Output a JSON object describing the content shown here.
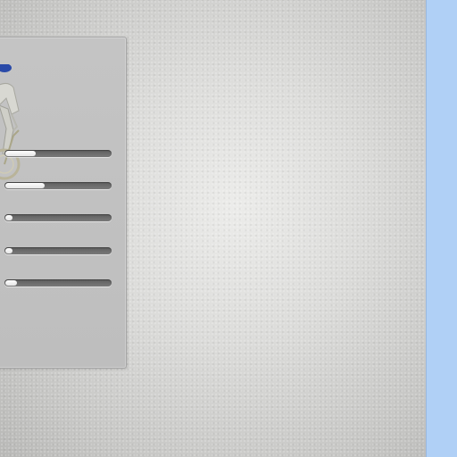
{
  "window": {
    "background": "#d9d9d7",
    "side_strip_color": "#b0d0f6"
  },
  "panel": {
    "figure_icon": "bicycle-rider-figure",
    "sliders": [
      {
        "name": "slider-1",
        "fraction": 0.29
      },
      {
        "name": "slider-2",
        "fraction": 0.37
      },
      {
        "name": "slider-3",
        "fraction": 0.03
      },
      {
        "name": "slider-4",
        "fraction": 0.06
      },
      {
        "name": "slider-5",
        "fraction": 0.11
      }
    ]
  }
}
